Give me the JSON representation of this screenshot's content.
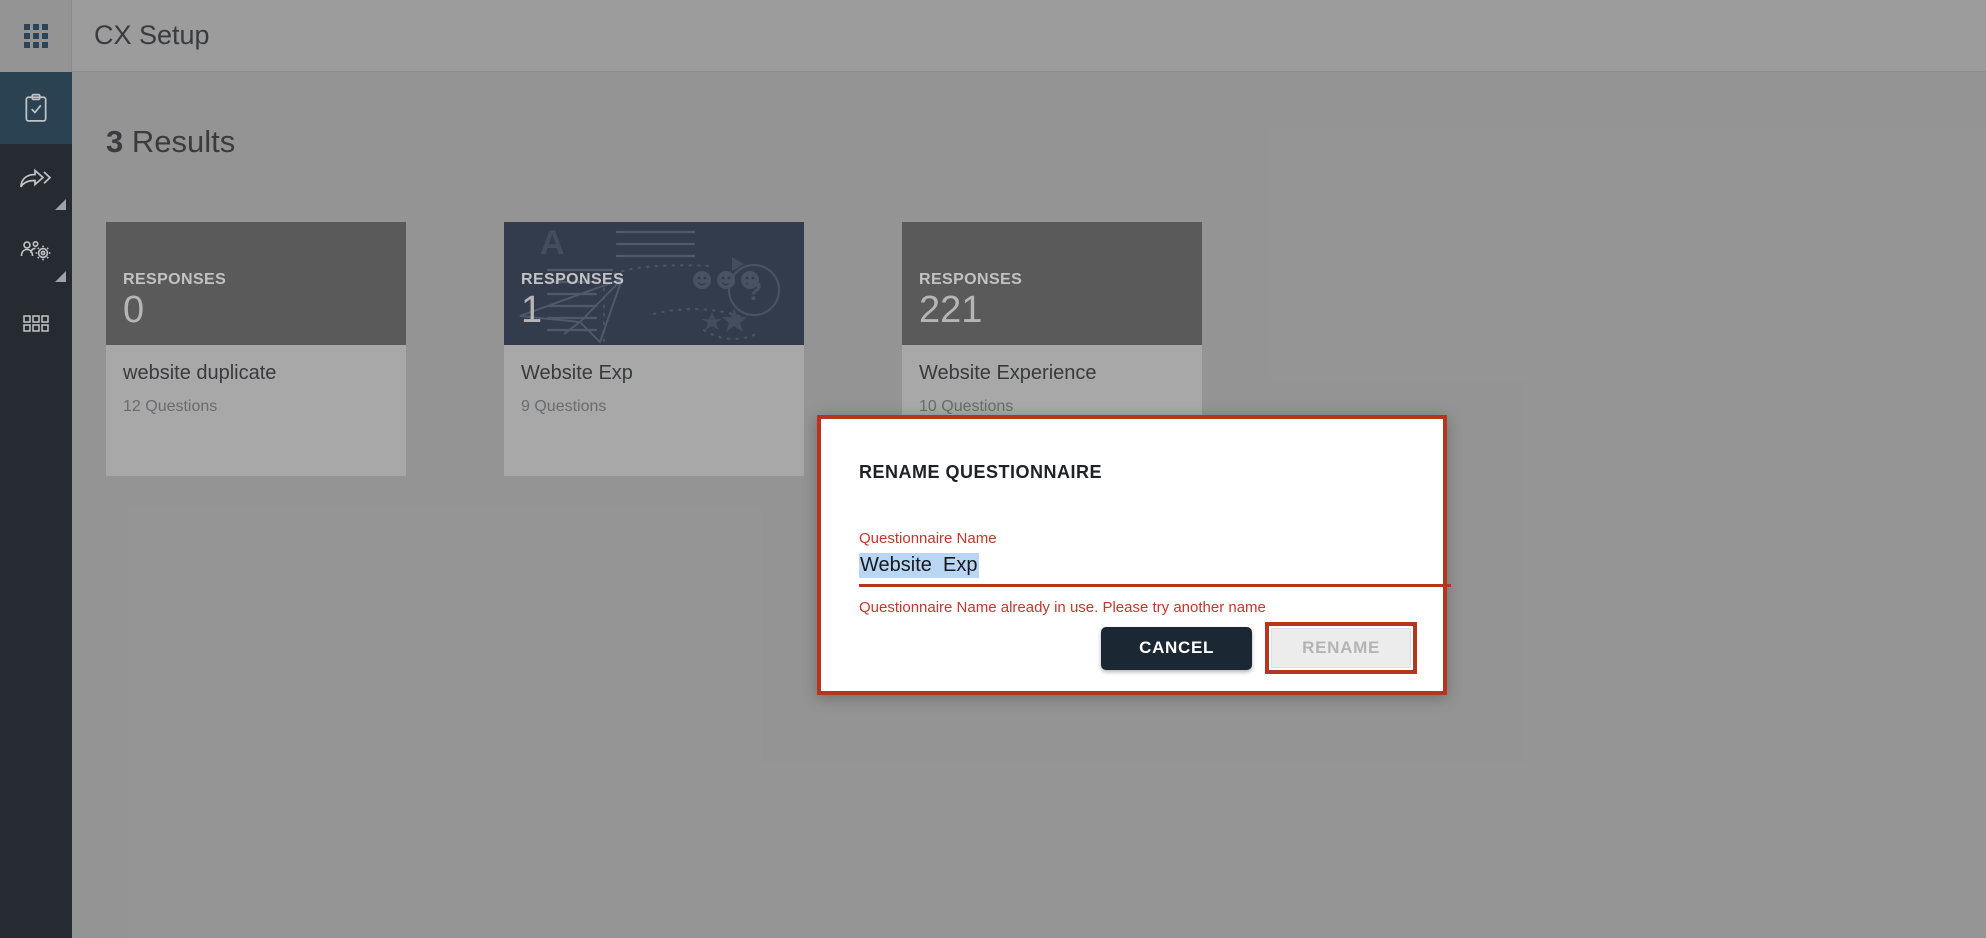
{
  "topbar": {
    "title": "CX Setup"
  },
  "rail": {
    "apps_icon": "apps-grid-icon",
    "items": [
      {
        "icon": "clipboard-check-icon",
        "active": true
      },
      {
        "icon": "share-arrow-icon",
        "active": false
      },
      {
        "icon": "users-gear-icon",
        "active": false
      },
      {
        "icon": "grid-dots-icon",
        "active": false
      }
    ]
  },
  "main": {
    "results_count": "3",
    "results_word": "Results",
    "responses_label": "RESPONSES",
    "cards": [
      {
        "count": "0",
        "title": "website duplicate",
        "questions": "12 Questions",
        "style": "plain"
      },
      {
        "count": "1",
        "title": "Website Exp",
        "questions": "9 Questions",
        "style": "art"
      },
      {
        "count": "221",
        "title": "Website Experience",
        "questions": "10 Questions",
        "style": "plain"
      }
    ]
  },
  "dialog": {
    "title": "RENAME QUESTIONNAIRE",
    "field_label": "Questionnaire Name",
    "field_value": "Website  Exp",
    "error": "Questionnaire Name already in use. Please try another name",
    "cancel_label": "CANCEL",
    "rename_label": "RENAME"
  },
  "colors": {
    "accent_red": "#b5351f",
    "error_red": "#c0392b",
    "dark_navy": "#1b2733",
    "card_art_bg": "#27334a",
    "card_plain_bg": "#5b5b5b",
    "rail_bg": "#151b24",
    "selection_blue": "#b9d6f5"
  }
}
